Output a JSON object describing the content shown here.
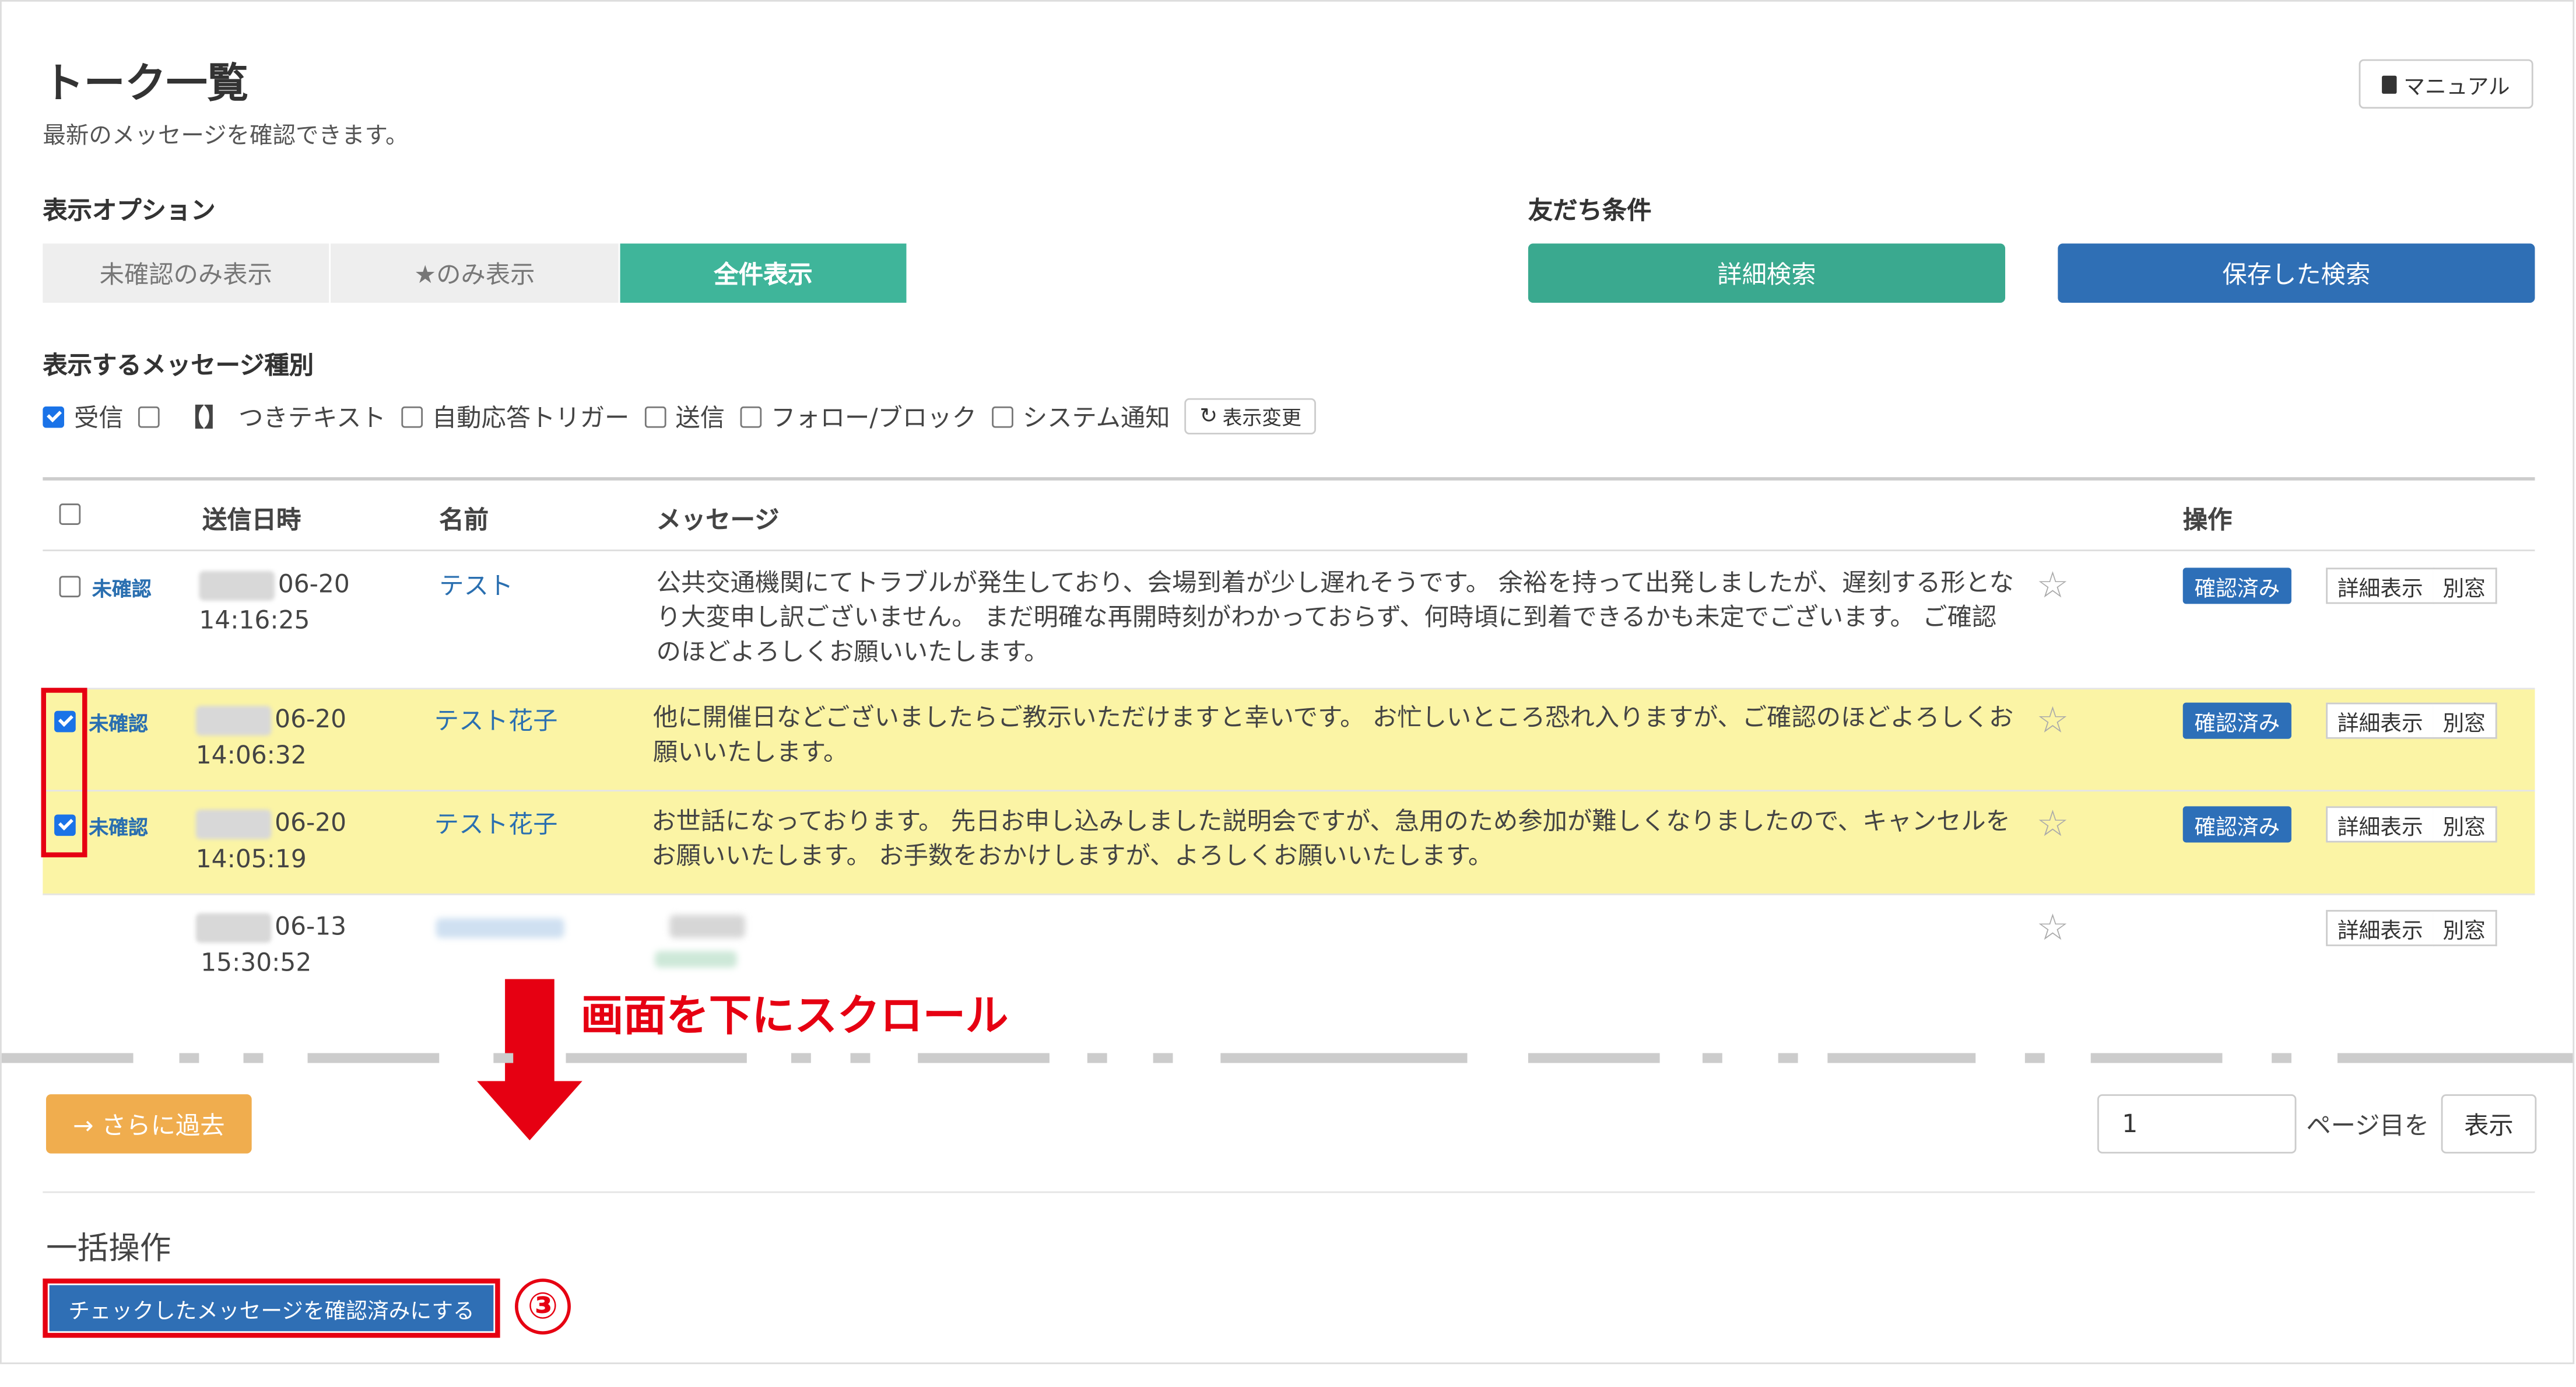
{
  "header": {
    "title": "トーク一覧",
    "subtitle": "最新のメッセージを確認できます。",
    "manual_label": "マニュアル"
  },
  "display_options": {
    "label": "表示オプション",
    "unconfirmed_only": "未確認のみ表示",
    "starred_only": "★のみ表示",
    "show_all": "全件表示"
  },
  "friend_conditions": {
    "label": "友だち条件",
    "detail_search": "詳細検索",
    "saved_search": "保存した検索"
  },
  "message_types": {
    "label": "表示するメッセージ種別",
    "received": "受信",
    "bracket_glyph": "【】",
    "bracket_text": "つきテキスト",
    "auto_reply": "自動応答トリガー",
    "sent": "送信",
    "follow_block": "フォロー/ブロック",
    "system": "システム通知",
    "refresh_label": "表示変更"
  },
  "table": {
    "columns": {
      "sent_at": "送信日時",
      "name": "名前",
      "message": "メッセージ",
      "actions": "操作"
    },
    "unconfirmed_label": "未確認",
    "confirm_label": "確認済み",
    "detail_label": "詳細表示",
    "window_label": "別窓",
    "rows": [
      {
        "date": "06-20",
        "time": "14:16:25",
        "name": "テスト",
        "message": "公共交通機関にてトラブルが発生しており、会場到着が少し遅れそうです。 余裕を持って出発しましたが、遅刻する形となり大変申し訳ございません。 まだ明確な再開時刻がわかっておらず、何時頃に到着できるかも未定でございます。 ご確認のほどよろしくお願いいたします。"
      },
      {
        "date": "06-20",
        "time": "14:06:32",
        "name": "テスト花子",
        "message": "他に開催日などございましたらご教示いただけますと幸いです。 お忙しいところ恐れ入りますが、ご確認のほどよろしくお願いいたします。"
      },
      {
        "date": "06-20",
        "time": "14:05:19",
        "name": "テスト花子",
        "message": "お世話になっております。 先日お申し込みしました説明会ですが、急用のため参加が難しくなりましたので、キャンセルをお願いいたします。 お手数をおかけしますが、よろしくお願いいたします。"
      },
      {
        "date": "06-13",
        "time": "15:30:52"
      }
    ]
  },
  "annotation": {
    "scroll_note": "画面を下にスクロール",
    "step_number": "③"
  },
  "pagination": {
    "past_label": "→ さらに過去",
    "page_value": "1",
    "page_suffix": "ページ目を",
    "show_label": "表示"
  },
  "bulk": {
    "title": "一括操作",
    "button_label": "チェックしたメッセージを確認済みにする"
  },
  "colors": {
    "accent_green": "#3fb59a",
    "accent_blue": "#2f6fb5",
    "highlight_yellow": "#fbf4a5",
    "annotation_red": "#e60012",
    "warning_orange": "#f0ad4e"
  }
}
